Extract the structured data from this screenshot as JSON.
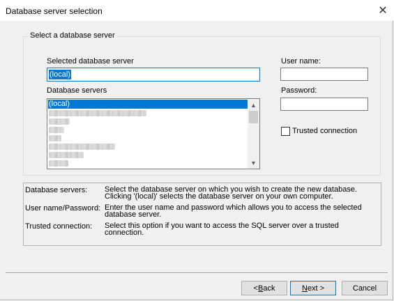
{
  "window": {
    "title": "Database server selection",
    "close_glyph": "✕"
  },
  "group": {
    "legend": "Select a database server",
    "selected_server_label": "Selected database server",
    "selected_server_value": "(local)",
    "servers_label": "Database servers",
    "servers": [
      {
        "label": "(local)",
        "selected": true
      },
      {
        "label": "",
        "redacted": true
      },
      {
        "label": "",
        "redacted": true
      },
      {
        "label": "",
        "redacted": true
      },
      {
        "label": "",
        "redacted": true
      },
      {
        "label": "",
        "redacted": true
      },
      {
        "label": "",
        "redacted": true
      },
      {
        "label": "",
        "redacted": true
      },
      {
        "label": "",
        "redacted": true
      }
    ],
    "scroll_up_icon": "▲",
    "scroll_down_icon": "▼",
    "username_label": "User name:",
    "username_value": "",
    "password_label": "Password:",
    "password_value": "",
    "trusted_label": "Trusted connection",
    "trusted_checked": false
  },
  "info": [
    {
      "key": "Database servers:",
      "text": "Select the database server on which you wish to create the new database. Clicking '(local)' selects the database server on your own computer."
    },
    {
      "key": "User name/Password:",
      "text": "Enter the user name and password which allows you to access the selected database server."
    },
    {
      "key": "Trusted connection:",
      "text": "Select this option if you want to access the SQL server over a trusted connection."
    }
  ],
  "buttons": {
    "back_prefix": "< ",
    "back_mnemonic": "B",
    "back_rest": "ack",
    "next_mnemonic": "N",
    "next_rest": "ext >",
    "cancel": "Cancel"
  }
}
